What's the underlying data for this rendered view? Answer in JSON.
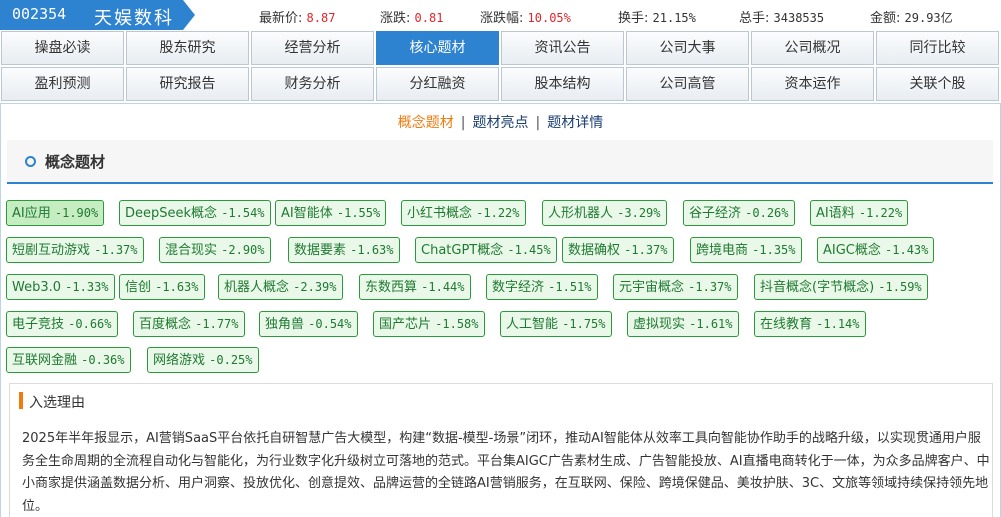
{
  "stock": {
    "code": "002354",
    "name": "天娱数科"
  },
  "quotes": [
    {
      "label": "最新价:",
      "value": "8.87",
      "red": true
    },
    {
      "label": "涨跌:",
      "value": "0.81",
      "red": true
    },
    {
      "label": "涨跌幅:",
      "value": "10.05%",
      "red": true
    },
    {
      "label": "换手:",
      "value": "21.15%",
      "red": false
    },
    {
      "label": "总手:",
      "value": "3438535",
      "red": false
    },
    {
      "label": "金额:",
      "value": "29.93亿",
      "red": false
    }
  ],
  "nav": {
    "row1": [
      "操盘必读",
      "股东研究",
      "经营分析",
      "核心题材",
      "资讯公告",
      "公司大事",
      "公司概况",
      "同行比较"
    ],
    "row2": [
      "盈利预测",
      "研究报告",
      "财务分析",
      "分红融资",
      "股本结构",
      "公司高管",
      "资本运作",
      "关联个股"
    ],
    "active": "核心题材"
  },
  "subnav": {
    "items": [
      "概念题材",
      "题材亮点",
      "题材详情"
    ],
    "separator": "|",
    "active": "概念题材"
  },
  "section": {
    "title": "概念题材"
  },
  "concepts": [
    {
      "name": "AI应用",
      "pct": "-1.90%"
    },
    {
      "name": "DeepSeek概念",
      "pct": "-1.54%"
    },
    {
      "name": "AI智能体",
      "pct": "-1.55%"
    },
    {
      "name": "小红书概念",
      "pct": "-1.22%"
    },
    {
      "name": "人形机器人",
      "pct": "-3.29%"
    },
    {
      "name": "谷子经济",
      "pct": "-0.26%"
    },
    {
      "name": "AI语料",
      "pct": "-1.22%"
    },
    {
      "name": "短剧互动游戏",
      "pct": "-1.37%"
    },
    {
      "name": "混合现实",
      "pct": "-2.90%"
    },
    {
      "name": "数据要素",
      "pct": "-1.63%"
    },
    {
      "name": "ChatGPT概念",
      "pct": "-1.45%"
    },
    {
      "name": "数据确权",
      "pct": "-1.37%"
    },
    {
      "name": "跨境电商",
      "pct": "-1.35%"
    },
    {
      "name": "AIGC概念",
      "pct": "-1.43%"
    },
    {
      "name": "Web3.0",
      "pct": "-1.33%"
    },
    {
      "name": "信创",
      "pct": "-1.63%"
    },
    {
      "name": "机器人概念",
      "pct": "-2.39%"
    },
    {
      "name": "东数西算",
      "pct": "-1.44%"
    },
    {
      "name": "数字经济",
      "pct": "-1.51%"
    },
    {
      "name": "元宇宙概念",
      "pct": "-1.37%"
    },
    {
      "name": "抖音概念(字节概念)",
      "pct": "-1.59%"
    },
    {
      "name": "电子竞技",
      "pct": "-0.66%"
    },
    {
      "name": "百度概念",
      "pct": "-1.77%"
    },
    {
      "name": "独角兽",
      "pct": "-0.54%"
    },
    {
      "name": "国产芯片",
      "pct": "-1.58%"
    },
    {
      "name": "人工智能",
      "pct": "-1.75%"
    },
    {
      "name": "虚拟现实",
      "pct": "-1.61%"
    },
    {
      "name": "在线教育",
      "pct": "-1.14%"
    },
    {
      "name": "互联网金融",
      "pct": "-0.36%"
    },
    {
      "name": "网络游戏",
      "pct": "-0.25%"
    }
  ],
  "reason": {
    "title": "入选理由",
    "text": "2025年半年报显示，AI营销SaaS平台依托自研智慧广告大模型，构建“数据-模型-场景”闭环，推动AI智能体从效率工具向智能协作助手的战略升级，以实现贯通用户服务全生命周期的全流程自动化与智能化，为行业数字化升级树立可落地的范式。平台集AIGC广告素材生成、广告智能投放、AI直播电商转化于一体，为众多品牌客户、中小商家提供涵盖数据分析、用户洞察、投放优化、创意提效、品牌运营的全链路AI营销服务，在互联网、保险、跨境保健品、美妆护肤、3C、文旅等领域持续保持领先地位。"
  },
  "colors": {
    "accent_blue": "#2e83d0",
    "tag_green": "#2a9a3a",
    "orange": "#f07c10",
    "red": "#e0252b"
  }
}
